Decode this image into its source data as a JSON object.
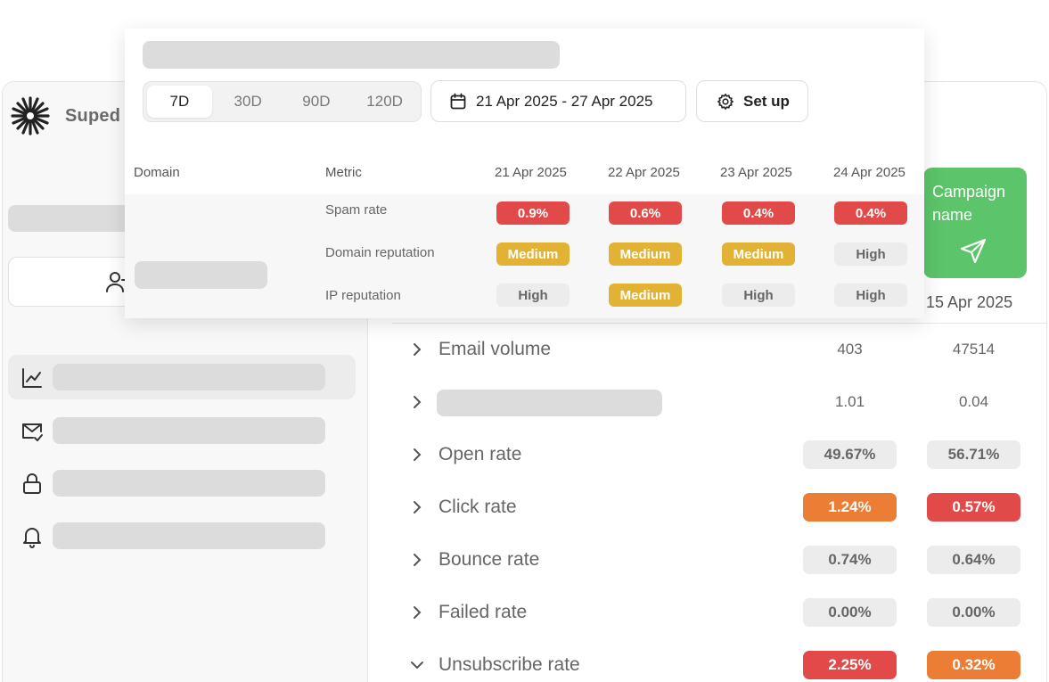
{
  "app": {
    "brand": "Suped"
  },
  "campaign": {
    "card_label": "Campaign name",
    "date": "15 Apr 2025"
  },
  "rows": [
    {
      "label": "Email volume",
      "v1": "403",
      "v2": "47514"
    },
    {
      "label": "",
      "v1": "1.01",
      "v2": "0.04"
    },
    {
      "label": "Open rate",
      "v1": "49.67%",
      "v2": "56.71%"
    },
    {
      "label": "Click rate",
      "v1": "1.24%",
      "v2": "0.57%"
    },
    {
      "label": "Bounce rate",
      "v1": "0.74%",
      "v2": "0.64%"
    },
    {
      "label": "Failed rate",
      "v1": "0.00%",
      "v2": "0.00%"
    },
    {
      "label": "Unsubscribe rate",
      "v1": "2.25%",
      "v2": "0.32%"
    }
  ],
  "popup": {
    "ranges": [
      "7D",
      "30D",
      "90D",
      "120D"
    ],
    "selected_range": "7D",
    "date_range": "21 Apr 2025 - 27 Apr 2025",
    "setup_label": "Set up",
    "headers": {
      "domain": "Domain",
      "metric": "Metric",
      "dates": [
        "21 Apr 2025",
        "22 Apr 2025",
        "23 Apr 2025",
        "24 Apr 2025"
      ]
    },
    "metrics": [
      {
        "name": "Spam rate",
        "values": [
          "0.9%",
          "0.6%",
          "0.4%",
          "0.4%"
        ]
      },
      {
        "name": "Domain reputation",
        "values": [
          "Medium",
          "Medium",
          "Medium",
          "High"
        ]
      },
      {
        "name": "IP reputation",
        "values": [
          "High",
          "Medium",
          "High",
          "High"
        ]
      }
    ]
  },
  "colors": {
    "green": "#5cc46a",
    "red": "#e24a4a",
    "orange": "#ec7d34",
    "yellow": "#e2b235"
  }
}
